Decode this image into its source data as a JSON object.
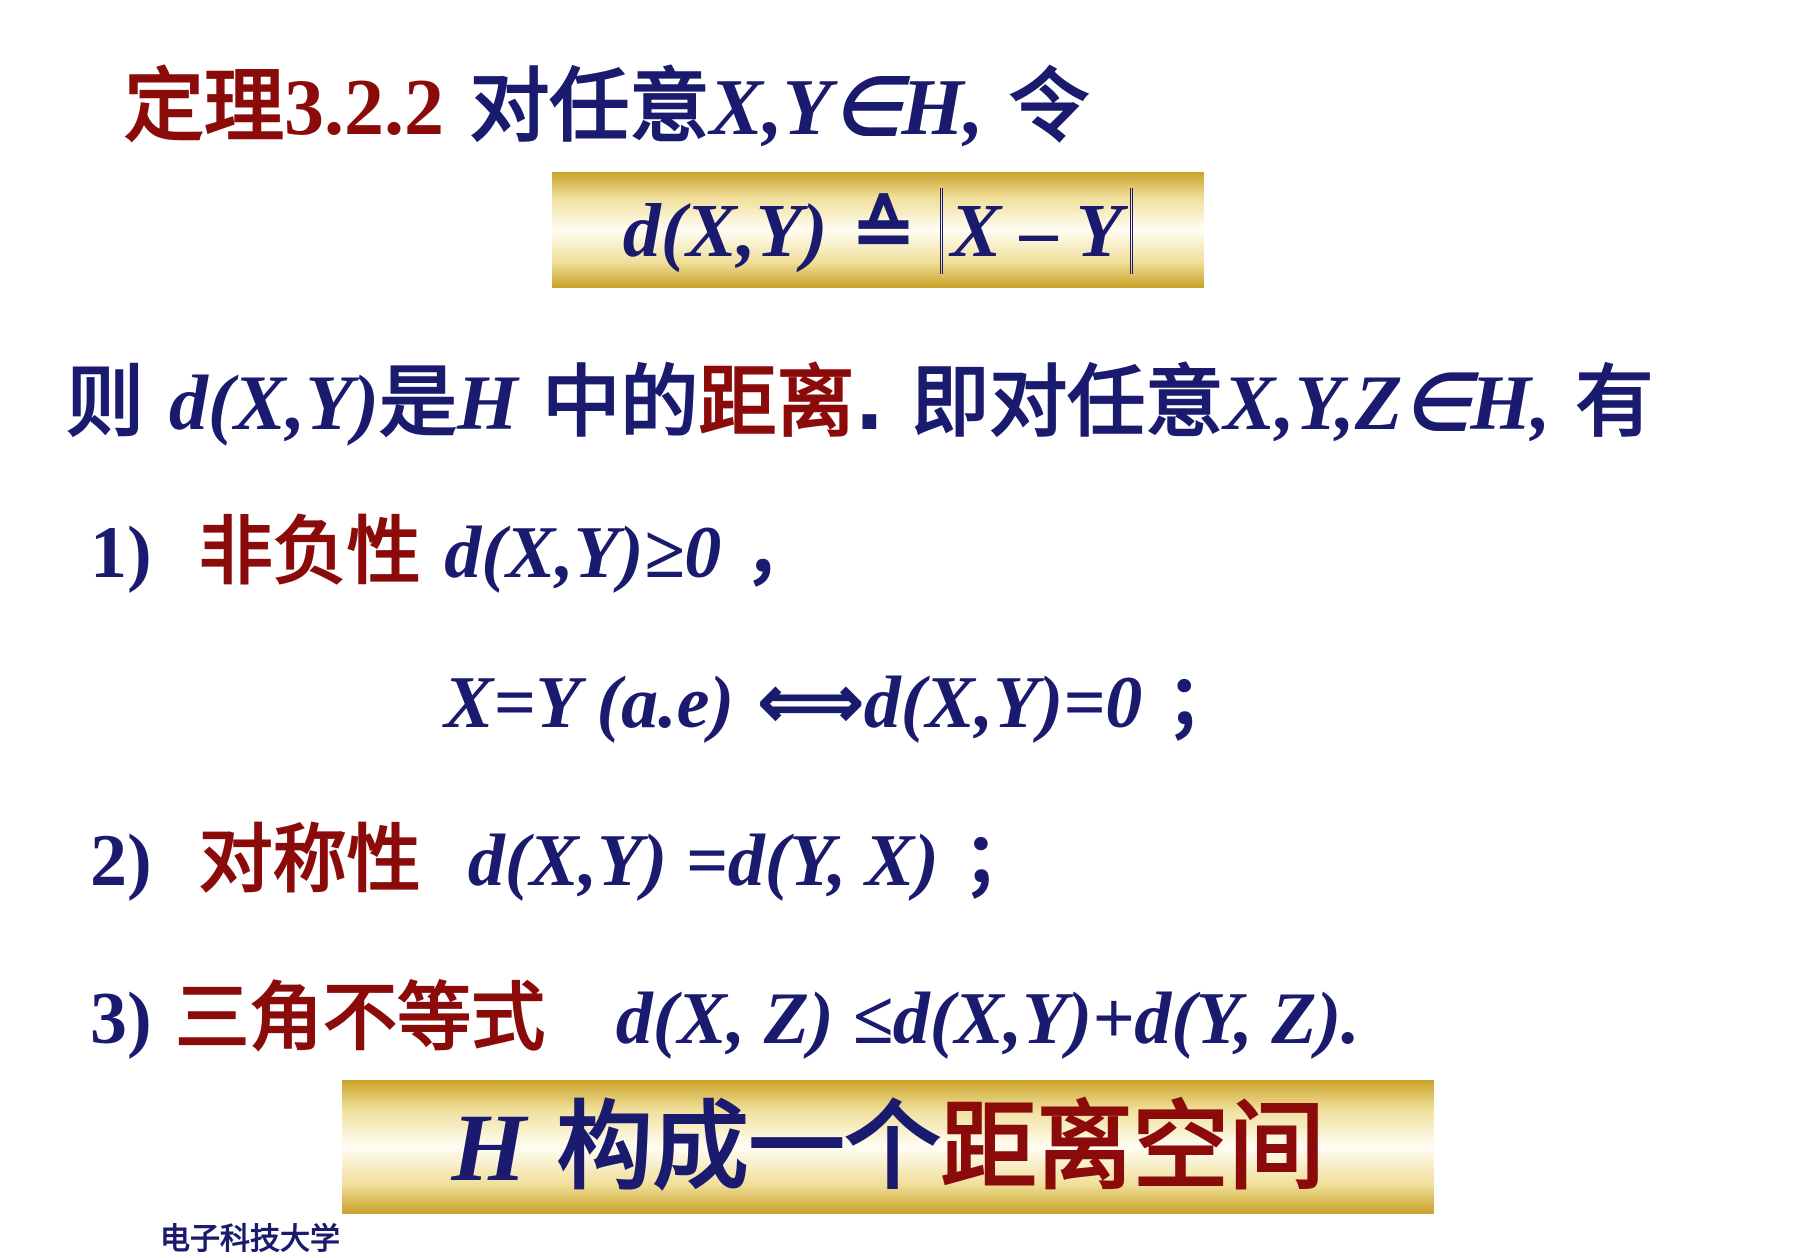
{
  "title": {
    "label": "定理",
    "number": "3.2.2",
    "text": "对任意",
    "vars": "X,Y∈H,",
    "tail": "令"
  },
  "formula": {
    "lhs": "d(X,Y)",
    "sym": "≙",
    "rhs": "X – Y"
  },
  "line3": {
    "p1": "则",
    "p2": "d(X,Y)",
    "p3": "是",
    "p4": "H",
    "p5": "中的",
    "p6": "距离",
    "p7": ". 即对任意",
    "p8": "X,Y,Z∈H,",
    "p9": "有"
  },
  "prop1": {
    "num": "1)",
    "name": "非负性",
    "expr": "d(X,Y)≥0",
    "punct": "，"
  },
  "eq1": {
    "expr": "X=Y (a.e)",
    "arrow": "⟺",
    "rhs": "d(X,Y)=0",
    "punct": "；"
  },
  "prop2": {
    "num": "2)",
    "name": "对称性",
    "expr": "d(X,Y) =d(Y, X)",
    "punct": "；"
  },
  "prop3": {
    "num": "3)",
    "name": "三角不等式",
    "expr": "d(X, Z) ≤d(X,Y)+d(Y, Z)."
  },
  "banner": {
    "var": "H",
    "p1": "构成一个",
    "p2": "距离空间"
  },
  "footer": {
    "text": "电子科技大学"
  },
  "colors": {
    "navy": "#1a1a6e",
    "red": "#8b0a0a",
    "gold": "#c9a227"
  }
}
